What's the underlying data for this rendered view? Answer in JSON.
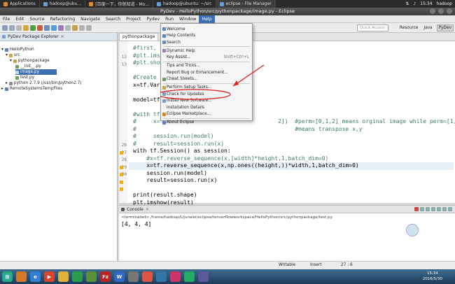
{
  "top_panel": {
    "tasks": [
      {
        "label": "Applications"
      },
      {
        "label": "hadoop@ubu..."
      },
      {
        "label": "[百度一下，你就知道 - Mo..."
      },
      {
        "label": "hadoop@ubuntu: ~/src"
      },
      {
        "label": "eclipse - File Manager"
      }
    ],
    "time": "15:34",
    "user": "hadoop"
  },
  "window": {
    "title": "PyDev - HelloPython/src/pythonpackage/image.py - Eclipse"
  },
  "menubar": [
    "File",
    "Edit",
    "Source",
    "Refactoring",
    "Navigate",
    "Search",
    "Project",
    "Pydev",
    "Run",
    "Window",
    "Help"
  ],
  "toolbar": {
    "quick_access": "Quick Access",
    "perspectives": [
      "Resource",
      "Java",
      "PyDev"
    ]
  },
  "package_explorer": {
    "tab": "PyDev Package Explorer",
    "items": [
      {
        "label": "HelloPython"
      },
      {
        "label": "src"
      },
      {
        "label": "pythonpackage"
      },
      {
        "label": "__init__.py"
      },
      {
        "label": "image.py"
      },
      {
        "label": "test.py"
      },
      {
        "label": "python 2.7.9  (/usr/bin/python2.7)"
      },
      {
        "label": "RemoteSystemsTempFiles"
      }
    ]
  },
  "editor": {
    "tab": "pythonpackage",
    "line_numbers": [
      "12",
      "13",
      "",
      "",
      "",
      "",
      "",
      "",
      "",
      "",
      "",
      "",
      "26",
      "27",
      "28",
      "29",
      "30",
      "",
      "",
      "",
      ""
    ],
    "lines": [
      "#first,",
      "#plt.ims",
      "#plt.show",
      "",
      "#Create",
      "x=tf.Var",
      "",
      "model=tf",
      "",
      "#with tf",
      "#     x=                                   2])  #perm=[0,1,2] means orginal image while perm=[1,0,2]",
      "#                                               #means transpose x,y",
      "#     session.run(model)",
      "#     result=session.run(x)",
      "with tf.Session() as session:",
      "    #x=tf.reverse_sequence(x,[width]*height,1,batch_dim=0)",
      "    x=tf.reverse_sequence(x,np.ones((height,))*width,1,batch_dim=0)",
      "    session.run(model)",
      "    result=session.run(x)",
      "",
      "print(result.shape)",
      "plt.imshow(result)",
      "plt.show()"
    ]
  },
  "console": {
    "tab": "Console",
    "header": "<terminated> /home/hadoop/Lijunwei/eclipse/tensorflowworkspace/HelloPython/src/pythonpackage/test.py",
    "output": "[4, 4, 4]"
  },
  "help_menu": {
    "items": [
      {
        "label": "Welcome",
        "accel": ""
      },
      {
        "label": "Help Contents",
        "accel": ""
      },
      {
        "label": "Search",
        "accel": ""
      },
      {
        "label": "Dynamic Help",
        "accel": ""
      },
      {
        "label": "Key Assist...",
        "accel": "Shift+Ctrl+L"
      },
      {
        "label": "Tips and Tricks...",
        "accel": ""
      },
      {
        "label": "Report Bug or Enhancement...",
        "accel": ""
      },
      {
        "label": "Cheat Sheets...",
        "accel": ""
      },
      {
        "label": "Perform Setup Tasks...",
        "accel": ""
      },
      {
        "label": "Check for Updates",
        "accel": ""
      },
      {
        "label": "Install New Software...",
        "accel": ""
      },
      {
        "label": "Installation Details",
        "accel": ""
      },
      {
        "label": "Eclipse Marketplace...",
        "accel": ""
      },
      {
        "label": "About Eclipse",
        "accel": ""
      }
    ]
  },
  "status": {
    "mode": "Writable",
    "insert": "Insert",
    "position": "27 : 6"
  },
  "taskbar": {
    "time": "15:34",
    "date": "2016/5/30"
  }
}
